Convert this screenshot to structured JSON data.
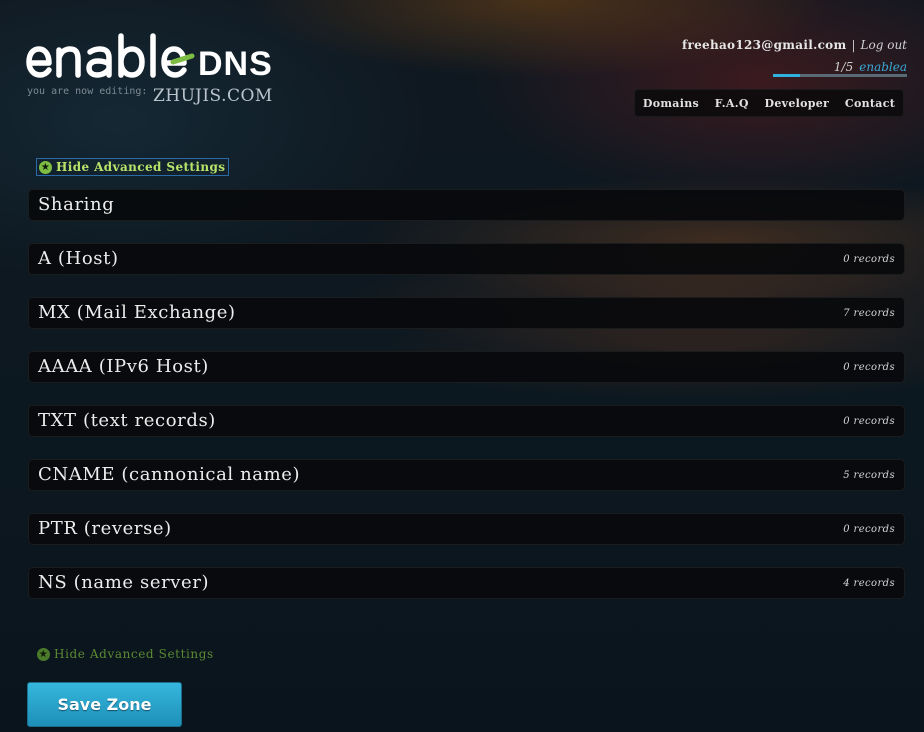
{
  "brand": {
    "logo_text": "enableDNS",
    "editing_label": "you are now editing:",
    "domain": "ZHUJIS.COM"
  },
  "account": {
    "email": "freehao123@gmail.com",
    "separator": "|",
    "logout": "Log out",
    "quota_text": "1/5",
    "username": "enablea",
    "quota_progress": 0.2
  },
  "nav": {
    "items": [
      "Domains",
      "F.A.Q",
      "Developer",
      "Contact"
    ]
  },
  "advanced": {
    "top_label": "Hide Advanced Settings",
    "bottom_label": "Hide Advanced Settings"
  },
  "records": [
    {
      "label": "Sharing",
      "count": ""
    },
    {
      "label": "A (Host)",
      "count": "0 records"
    },
    {
      "label": "MX (Mail Exchange)",
      "count": "7 records"
    },
    {
      "label": "AAAA (IPv6 Host)",
      "count": "0 records"
    },
    {
      "label": "TXT (text records)",
      "count": "0 records"
    },
    {
      "label": "CNAME (cannonical name)",
      "count": "5 records"
    },
    {
      "label": "PTR (reverse)",
      "count": "0 records"
    },
    {
      "label": "NS (name server)",
      "count": "4 records"
    }
  ],
  "save_button": "Save Zone",
  "colors": {
    "accent": "#2fb2e0",
    "green": "#7dbd43",
    "row_bg": "#08090b"
  }
}
